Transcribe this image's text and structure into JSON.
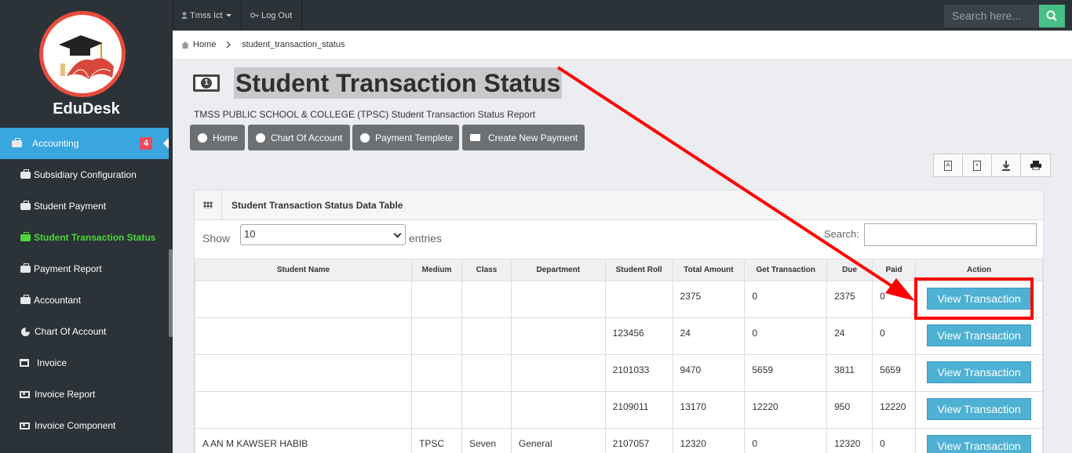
{
  "app": {
    "brand": "EduDesk"
  },
  "sidebar": {
    "items": [
      {
        "label": "Accounting",
        "badge": "4",
        "icon": "briefcase-icon"
      },
      {
        "label": "Subsidiary Configuration",
        "icon": "briefcase-icon"
      },
      {
        "label": "Student Payment",
        "icon": "briefcase-icon"
      },
      {
        "label": "Student Transaction Status",
        "icon": "briefcase-icon"
      },
      {
        "label": "Payment Report",
        "icon": "briefcase-icon"
      },
      {
        "label": "Accountant",
        "icon": "briefcase-icon"
      },
      {
        "label": "Chart Of Account",
        "icon": "pie-chart-icon"
      },
      {
        "label": "Invoice",
        "icon": "window-icon"
      },
      {
        "label": "Invoice Report",
        "icon": "money-icon"
      },
      {
        "label": "Invoice Component",
        "icon": "money-icon"
      }
    ]
  },
  "topbar": {
    "user": "Tmss Ict",
    "logout": "Log Out",
    "search_placeholder": "Search here..."
  },
  "breadcrumb": {
    "home": "Home",
    "current": "student_transaction_status"
  },
  "page": {
    "title": "Student Transaction Status",
    "subtitle": "TMSS PUBLIC SCHOOL & COLLEGE (TPSC) Student Transaction Status Report"
  },
  "actions": {
    "home": "Home",
    "chart_of_account": "Chart Of Account",
    "payment_template": "Payment Templete",
    "create_payment": "Create New Payment"
  },
  "export_tools": [
    "pdf-icon",
    "excel-icon",
    "download-icon",
    "print-icon"
  ],
  "panel": {
    "title": "Student Transaction Status Data Table",
    "show_label": "Show",
    "show_value": "10",
    "entries_label": "entries",
    "search_label": "Search:"
  },
  "table": {
    "columns": [
      "Student Name",
      "Medium",
      "Class",
      "Department",
      "Student Roll",
      "Total Amount",
      "Get Transaction",
      "Due",
      "Paid",
      "Action"
    ],
    "rows": [
      [
        "",
        "",
        "",
        "",
        "",
        "2375",
        "0",
        "2375",
        "0"
      ],
      [
        "",
        "",
        "",
        "",
        "123456",
        "24",
        "0",
        "24",
        "0"
      ],
      [
        "",
        "",
        "",
        "",
        "2101033",
        "9470",
        "5659",
        "3811",
        "5659"
      ],
      [
        "",
        "",
        "",
        "",
        "2109011",
        "13170",
        "12220",
        "950",
        "12220"
      ],
      [
        "A AN M KAWSER HABIB",
        "TPSC",
        "Seven",
        "General",
        "2107057",
        "12320",
        "0",
        "12320",
        "0"
      ]
    ],
    "action_label": "View Transaction"
  },
  "colors": {
    "accent": "#3aa6e0",
    "active_text": "#4fd63b",
    "annotation": "#ff0000",
    "button": "#4eb1d3"
  }
}
